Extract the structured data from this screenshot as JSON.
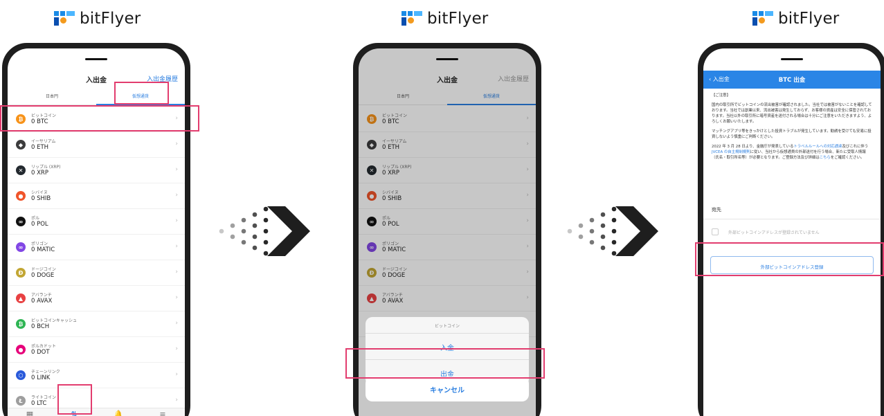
{
  "brand": {
    "name": "bitFlyer"
  },
  "colors": {
    "accent": "#2a7ee0",
    "highlight": "#e23c6e",
    "nav": "#2a85e6"
  },
  "screen1": {
    "title": "入出金",
    "history": "入出金履歴",
    "tabs": [
      "日本円",
      "仮想通貨"
    ],
    "coins": [
      {
        "name": "ビットコイン",
        "balance": "0 BTC",
        "icon": "btc-icon",
        "color": "#f7931a",
        "glyph": "₿"
      },
      {
        "name": "イーサリアム",
        "balance": "0 ETH",
        "icon": "eth-icon",
        "color": "#3c3c3d",
        "glyph": "◆"
      },
      {
        "name": "リップル (XRP)",
        "balance": "0 XRP",
        "icon": "xrp-icon",
        "color": "#23292f",
        "glyph": "✕"
      },
      {
        "name": "シバイヌ",
        "balance": "0 SHIB",
        "icon": "shib-icon",
        "color": "#f0552b",
        "glyph": "●"
      },
      {
        "name": "ポル",
        "balance": "0 POL",
        "icon": "pol-icon",
        "color": "#111111",
        "glyph": "∞"
      },
      {
        "name": "ポリゴン",
        "balance": "0 MATIC",
        "icon": "matic-icon",
        "color": "#8247e5",
        "glyph": "∞"
      },
      {
        "name": "ドージコイン",
        "balance": "0 DOGE",
        "icon": "doge-icon",
        "color": "#c2a633",
        "glyph": "Ð"
      },
      {
        "name": "アバランチ",
        "balance": "0 AVAX",
        "icon": "avax-icon",
        "color": "#e84142",
        "glyph": "▲"
      },
      {
        "name": "ビットコインキャッシュ",
        "balance": "0 BCH",
        "icon": "bch-icon",
        "color": "#2fb554",
        "glyph": "₿"
      },
      {
        "name": "ポルカドット",
        "balance": "0 DOT",
        "icon": "dot-icon",
        "color": "#e6007a",
        "glyph": "●"
      },
      {
        "name": "チェーンリンク",
        "balance": "0 LINK",
        "icon": "link-icon",
        "color": "#2a5ada",
        "glyph": "⬡"
      },
      {
        "name": "ライトコイン",
        "balance": "0 LTC",
        "icon": "ltc-icon",
        "color": "#9e9e9e",
        "glyph": "Ł"
      }
    ],
    "tabbar": [
      {
        "label": "ホーム",
        "icon": "home-icon",
        "glyph": "▦"
      },
      {
        "label": "入出金",
        "icon": "transfer-icon",
        "glyph": "⇅"
      },
      {
        "label": "お知らせ",
        "icon": "bell-icon",
        "glyph": "🔔"
      },
      {
        "label": "メニュー",
        "icon": "menu-icon",
        "glyph": "≡"
      }
    ]
  },
  "screen2": {
    "title": "入出金",
    "history": "入出金履歴",
    "tabs": [
      "日本円",
      "仮想通貨"
    ],
    "coins": [
      {
        "name": "ビットコイン",
        "balance": "0 BTC",
        "icon": "btc-icon",
        "color": "#f7931a",
        "glyph": "₿"
      },
      {
        "name": "イーサリアム",
        "balance": "0 ETH",
        "icon": "eth-icon",
        "color": "#3c3c3d",
        "glyph": "◆"
      },
      {
        "name": "リップル (XRP)",
        "balance": "0 XRP",
        "icon": "xrp-icon",
        "color": "#23292f",
        "glyph": "✕"
      },
      {
        "name": "シバイヌ",
        "balance": "0 SHIB",
        "icon": "shib-icon",
        "color": "#f0552b",
        "glyph": "●"
      },
      {
        "name": "ポル",
        "balance": "0 POL",
        "icon": "pol-icon",
        "color": "#111111",
        "glyph": "∞"
      },
      {
        "name": "ポリゴン",
        "balance": "0 MATIC",
        "icon": "matic-icon",
        "color": "#8247e5",
        "glyph": "∞"
      },
      {
        "name": "ドージコイン",
        "balance": "0 DOGE",
        "icon": "doge-icon",
        "color": "#c2a633",
        "glyph": "Ð"
      },
      {
        "name": "アバランチ",
        "balance": "0 AVAX",
        "icon": "avax-icon",
        "color": "#e84142",
        "glyph": "▲"
      },
      {
        "name": "ビットコインキャッシュ",
        "balance": "0 BCH",
        "icon": "bch-icon",
        "color": "#2fb554",
        "glyph": "₿"
      }
    ],
    "sheet": {
      "title": "ビットコイン",
      "deposit": "入金",
      "withdraw": "出金",
      "cancel": "キャンセル"
    }
  },
  "screen3": {
    "back": "入出金",
    "title": "BTC 出金",
    "notice_heading": "【ご注意】",
    "notice_p1": "国内の取引所でビットコインの流出被害が確認されました。当社では被害がないことを確認しております。当社では創業以来、流出被害は発生しておらず、お客様の資産は安全に保管されております。当社以外の取引所に暗号資産を送付される場合は十分にご注意をいただきますよう、よろしくお願いいたします。",
    "notice_p2": "マッチングアプリ等をきっかけとした投資トラブルが発生しています。勧誘を受けても安易に投資しないよう慎重にご判断ください。",
    "notice_p3a": "2022 年 3 月 28 日より、金融庁が発表している",
    "notice_p3_link1": "トラベルルールへの対応通達",
    "notice_p3b": "及びこれに伴う",
    "notice_p3_link2": "JVCEA の自主規制規則",
    "notice_p3c": "に従い、当社から仮想通貨の外部送付を行う場合、新たに受取人情報（氏名・取引所名等）が必要となります。ご登録方法及び詳細は",
    "notice_p3_link3": "こちら",
    "notice_p3d": "をご確認ください。",
    "dest_label": "宛先",
    "no_dest": "外部ビットコインアドレスが登録されていません",
    "register": "外部ビットコインアドレス登録"
  }
}
